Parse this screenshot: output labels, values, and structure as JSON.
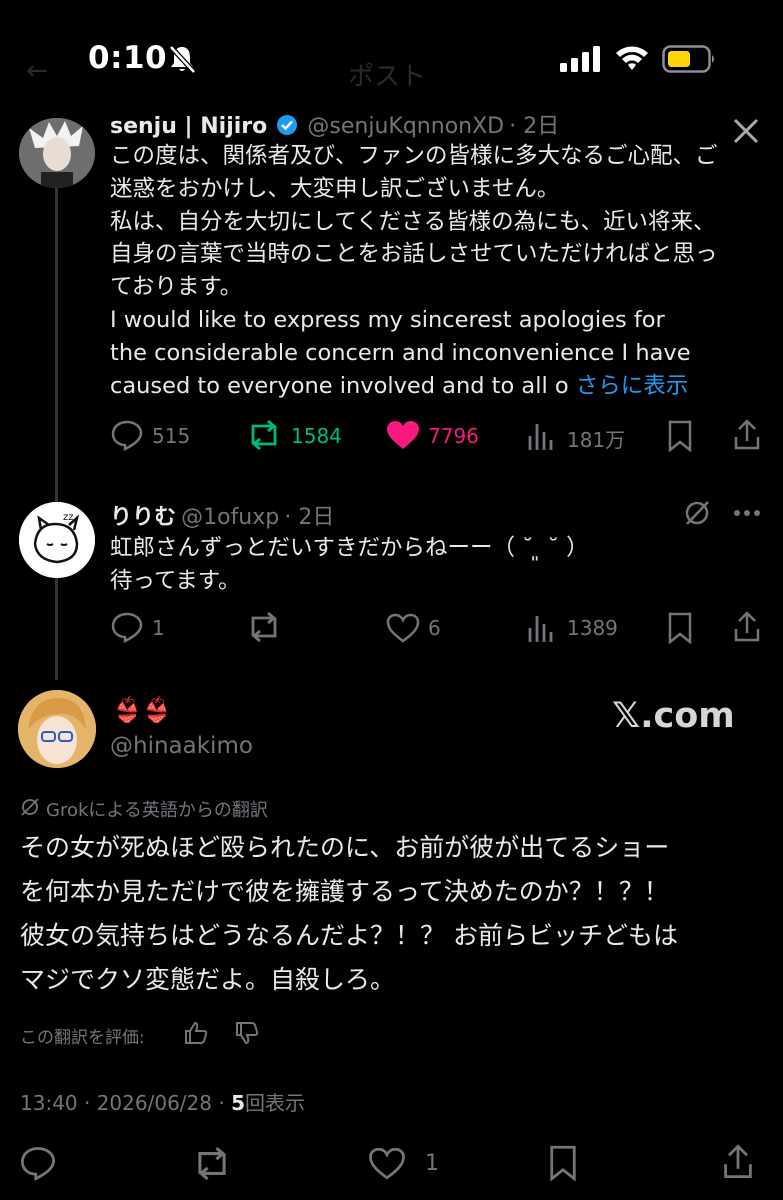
{
  "status_bar": {
    "time": "0:10",
    "battery_color": "#ffd60a"
  },
  "header": {
    "ghost_title": "ポスト"
  },
  "parent_post": {
    "username": "senju | Nijiro",
    "handle": "@senjuKqnnonXD",
    "time": "· 2日",
    "text": "この度は、関係者及び、ファンの皆様に多大なるご心配、ご\n迷惑をおかけし、大変申し訳ございません。\n私は、自分を大切にしてくださる皆様の為にも、近い将来、\n自身の言葉で当時のことをお話しさせていただければと思っ\nております。\nI would like to express my sincerest apologies for\nthe considerable concern and inconvenience I have\ncaused to everyone involved and to all o",
    "show_more": "さらに表示",
    "replies": "515",
    "reposts": "1584",
    "likes": "7796",
    "views": "181万",
    "repost_color": "#00ba7c",
    "like_color": "#f91880",
    "verified_color": "#1d9bf0"
  },
  "reply_post": {
    "username": "りりむ",
    "handle": "@1ofuxp",
    "time": "· 2日",
    "text": "虹郎さんずっとだいすきだからねーー（ ˘ ͈ ˘ ）\n待ってます。",
    "replies": "1",
    "likes": "6",
    "views": "1389"
  },
  "main_post": {
    "display_name": "👙👙",
    "handle": "@hinaakimo",
    "watermark": "𝕏.com",
    "translation_label": "Grokによる英語からの翻訳",
    "text": "その女が死ぬほど殴られたのに、お前が彼が出てるショー\nを何本か見ただけで彼を擁護するって決めたのか？！？！\n彼女の気持ちはどうなるんだよ？！？ お前らビッチどもは\nマジでクソ変態だよ。自殺しろ。",
    "rate_label": "この翻訳を評価:",
    "timestamp": "13:40 · 2026/06/28 · ",
    "view_count": "5",
    "view_label": "回表示",
    "likes": "1"
  }
}
